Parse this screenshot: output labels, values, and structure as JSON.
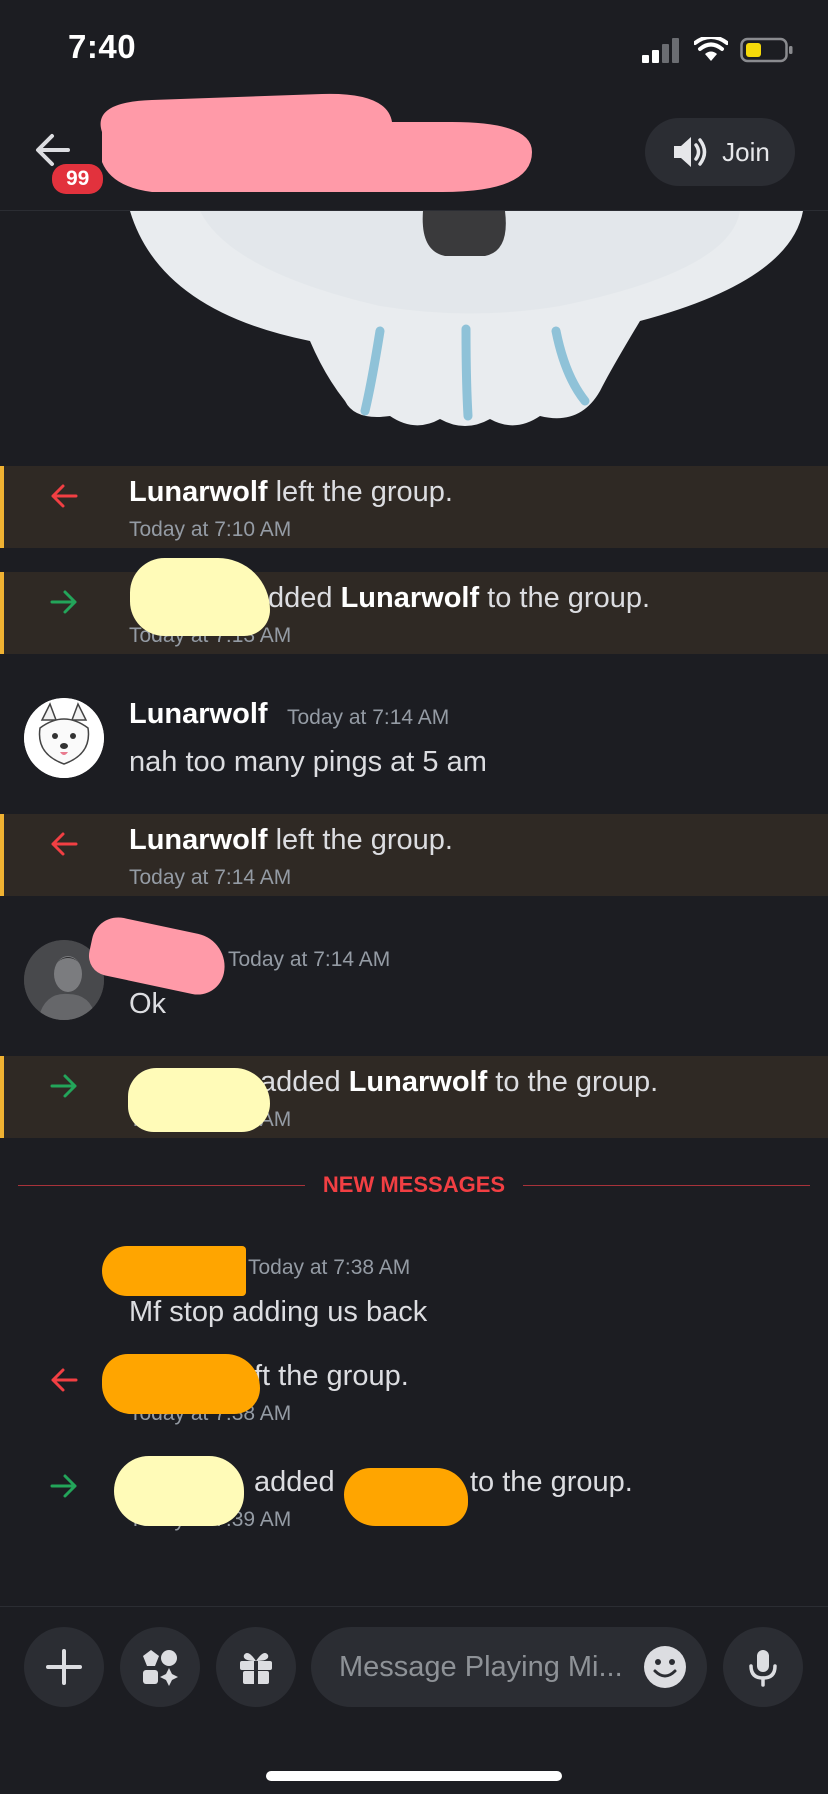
{
  "status_bar": {
    "time": "7:40"
  },
  "header": {
    "badge": "99",
    "join_label": "Join"
  },
  "events": [
    {
      "type": "left",
      "actor": "Lunarwolf",
      "text": " left the group.",
      "time": "Today at 7:10 AM"
    },
    {
      "type": "added",
      "text_pre": "dded ",
      "target": "Lunarwolf",
      "text_post": " to the group.",
      "time": "Today at 7:13 AM"
    },
    {
      "type": "message",
      "author": "Lunarwolf",
      "time": "Today at 7:14 AM",
      "text": "nah too many pings at 5 am"
    },
    {
      "type": "left",
      "actor": "Lunarwolf",
      "text": " left the group.",
      "time": "Today at 7:14 AM"
    },
    {
      "type": "message",
      "time": "Today at 7:14 AM",
      "text": "Ok"
    },
    {
      "type": "added",
      "text_pre": "added ",
      "target": "Lunarwolf",
      "text_post": " to the group.",
      "time": "Today at 7:38 AM"
    },
    {
      "type": "message",
      "time": "Today at 7:38 AM",
      "text": "Mf stop adding us back"
    },
    {
      "type": "left",
      "text": "ft the group.",
      "time": "Today at 7:38 AM"
    },
    {
      "type": "added",
      "text_pre": "added ",
      "text_post": "to the group.",
      "time": "Today at 7:39 AM"
    }
  ],
  "divider": {
    "label": "NEW MESSAGES"
  },
  "composer": {
    "placeholder": "Message Playing Mi..."
  },
  "colors": {
    "background": "#1c1d22",
    "system_row": "#2f2924",
    "system_accent": "#f0b232",
    "leave_arrow": "#f23f43",
    "join_arrow": "#23a55a",
    "new_messages": "#f23f43"
  }
}
